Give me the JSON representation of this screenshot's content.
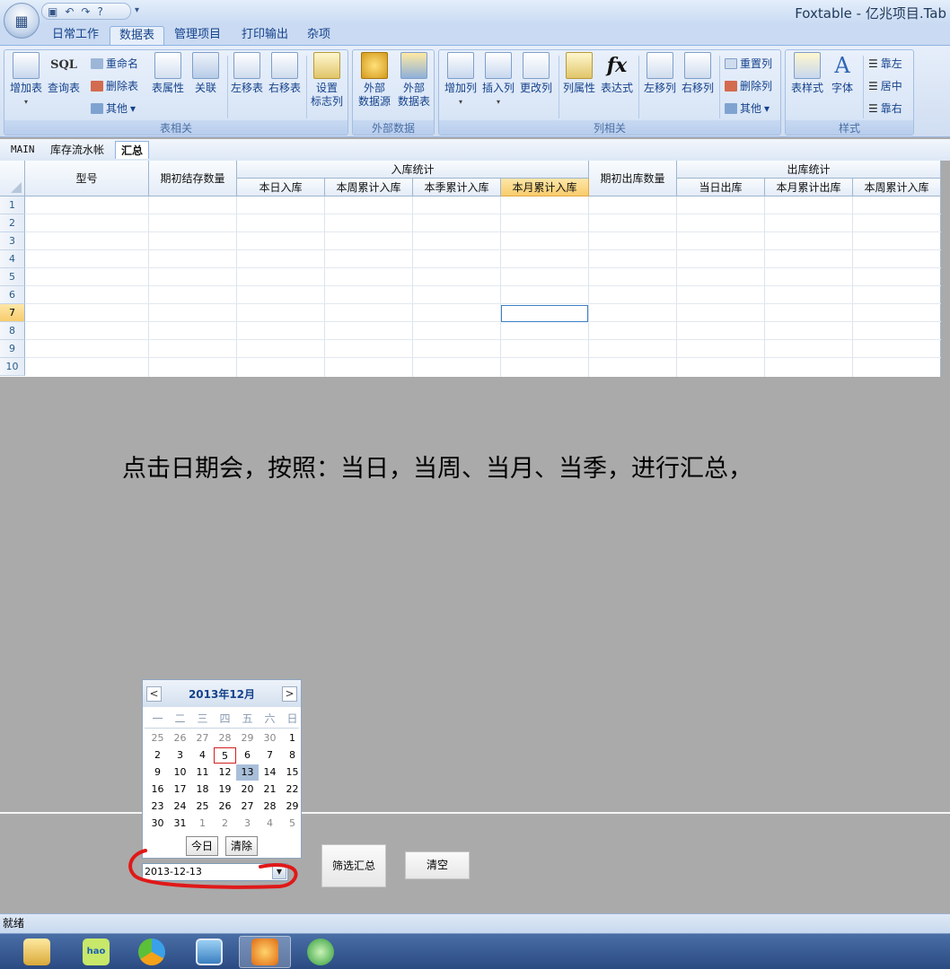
{
  "titlebar": {
    "app_title": "Foxtable - 亿兆项目.Tab",
    "qat_icons": [
      "save-icon",
      "undo-icon",
      "redo-icon",
      "help-icon"
    ]
  },
  "ribbon_tabs": [
    "日常工作",
    "数据表",
    "管理项目",
    "打印输出",
    "杂项"
  ],
  "ribbon_active_tab": "数据表",
  "ribbon": {
    "table_group": {
      "title": "表相关",
      "add_table": "增加表",
      "query_table": "查询表",
      "rename": "重命名",
      "delete_table": "删除表",
      "other": "其他",
      "table_props": "表属性",
      "relation": "关联",
      "move_left": "左移表",
      "move_right": "右移表",
      "set_flag_col_1": "设置",
      "set_flag_col_2": "标志列"
    },
    "external_group": {
      "title": "外部数据",
      "ext_source_1": "外部",
      "ext_source_2": "数据源",
      "ext_table_1": "外部",
      "ext_table_2": "数据表"
    },
    "column_group": {
      "title": "列相关",
      "add_col": "增加列",
      "insert_col": "插入列",
      "change_col": "更改列",
      "col_props": "列属性",
      "expression": "表达式",
      "left_col": "左移列",
      "right_col": "右移列",
      "reset_col": "重置列",
      "delete_col": "删除列",
      "other": "其他"
    },
    "style_group": {
      "title": "样式",
      "table_style": "表样式",
      "font": "字体",
      "align_left": "靠左",
      "align_center": "居中",
      "align_right": "靠右"
    }
  },
  "sheet_tabs": [
    "MAIN",
    "库存流水帐",
    "汇总"
  ],
  "sheet_active": "汇总",
  "grid": {
    "col_model": "型号",
    "col_opening_stock": "期初结存数量",
    "group_in": "入库统计",
    "in_cols": [
      "本日入库",
      "本周累计入库",
      "本季累计入库",
      "本月累计入库"
    ],
    "col_opening_out": "期初出库数量",
    "group_out": "出库统计",
    "out_cols": [
      "当日出库",
      "本月累计出库",
      "本周累计入库"
    ],
    "rows": [
      "1",
      "2",
      "3",
      "4",
      "5",
      "6",
      "7",
      "8",
      "9",
      "10"
    ],
    "highlight_row": "7",
    "highlight_col": "本月累计入库"
  },
  "message": "点击日期会，按照：当日，当周、当月、当季，进行汇总，",
  "calendar": {
    "month_title": "2013年12月",
    "prev_label": "<",
    "next_label": ">",
    "weekdays": [
      "一",
      "二",
      "三",
      "四",
      "五",
      "六",
      "日"
    ],
    "days": [
      [
        "25",
        "26",
        "27",
        "28",
        "29",
        "30",
        "1"
      ],
      [
        "2",
        "3",
        "4",
        "5",
        "6",
        "7",
        "8"
      ],
      [
        "9",
        "10",
        "11",
        "12",
        "13",
        "14",
        "15"
      ],
      [
        "16",
        "17",
        "18",
        "19",
        "20",
        "21",
        "22"
      ],
      [
        "23",
        "24",
        "25",
        "26",
        "27",
        "28",
        "29"
      ],
      [
        "30",
        "31",
        "1",
        "2",
        "3",
        "4",
        "5"
      ]
    ],
    "today_day": "5",
    "selected_day": "13",
    "today_button": "今日",
    "clear_button": "清除"
  },
  "date_input": {
    "value": "2013-12-13"
  },
  "buttons": {
    "filter_summary": "筛选汇总",
    "clear": "清空"
  },
  "status": "就绪",
  "taskbar_apps": [
    "explorer-icon",
    "hao123-icon",
    "browser-icon",
    "picture-viewer-icon",
    "foxtable-icon",
    "update-icon"
  ],
  "colors": {
    "highlight": "#f8cc6c",
    "accent": "#15428b",
    "annotation_red": "#e01818"
  }
}
